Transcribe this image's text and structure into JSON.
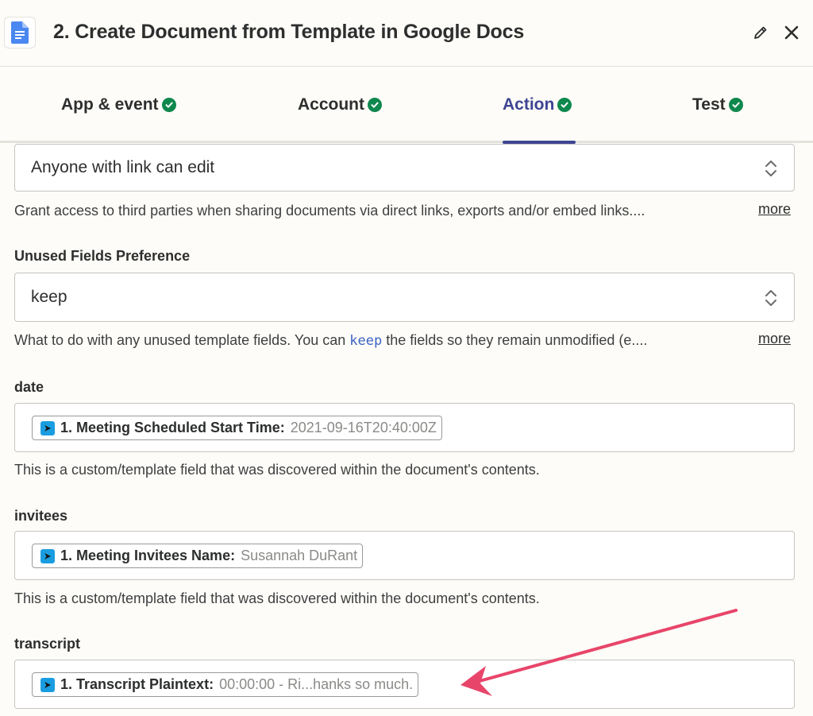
{
  "header": {
    "title": "2. Create Document from Template in Google Docs"
  },
  "tabs": [
    {
      "label": "App & event",
      "active": false,
      "complete": true
    },
    {
      "label": "Account",
      "active": false,
      "complete": true
    },
    {
      "label": "Action",
      "active": true,
      "complete": true
    },
    {
      "label": "Test",
      "active": false,
      "complete": true
    }
  ],
  "sharing": {
    "value": "Anyone with link can edit",
    "help": "Grant access to third parties when sharing documents via direct links, exports and/or embed links....",
    "more": "more"
  },
  "unused_fields": {
    "label": "Unused Fields Preference",
    "value": "keep",
    "help_before": "What to do with any unused template fields. You can ",
    "help_code": "keep",
    "help_after": " the fields so they remain unmodified (e....",
    "more": "more"
  },
  "date": {
    "label": "date",
    "pill_key": "1. Meeting Scheduled Start Time:",
    "pill_value": "2021-09-16T20:40:00Z",
    "help": "This is a custom/template field that was discovered within the document's contents."
  },
  "invitees": {
    "label": "invitees",
    "pill_key": "1. Meeting Invitees Name:",
    "pill_value": "Susannah DuRant",
    "help": "This is a custom/template field that was discovered within the document's contents."
  },
  "transcript": {
    "label": "transcript",
    "pill_key": "1. Transcript Plaintext:",
    "pill_value": "00:00:00 - Ri...hanks so much."
  },
  "colors": {
    "accent": "#3d4592",
    "success": "#0f884e",
    "arrow": "#e8456a",
    "app_icon": "#1a9de0"
  },
  "icons": {
    "header_app": "google-docs-icon",
    "edit": "pencil-icon",
    "close": "close-icon",
    "tab_check": "check-circle-icon",
    "select_chevron": "updown-chevron-icon",
    "pill_app": "fathom-app-icon"
  }
}
